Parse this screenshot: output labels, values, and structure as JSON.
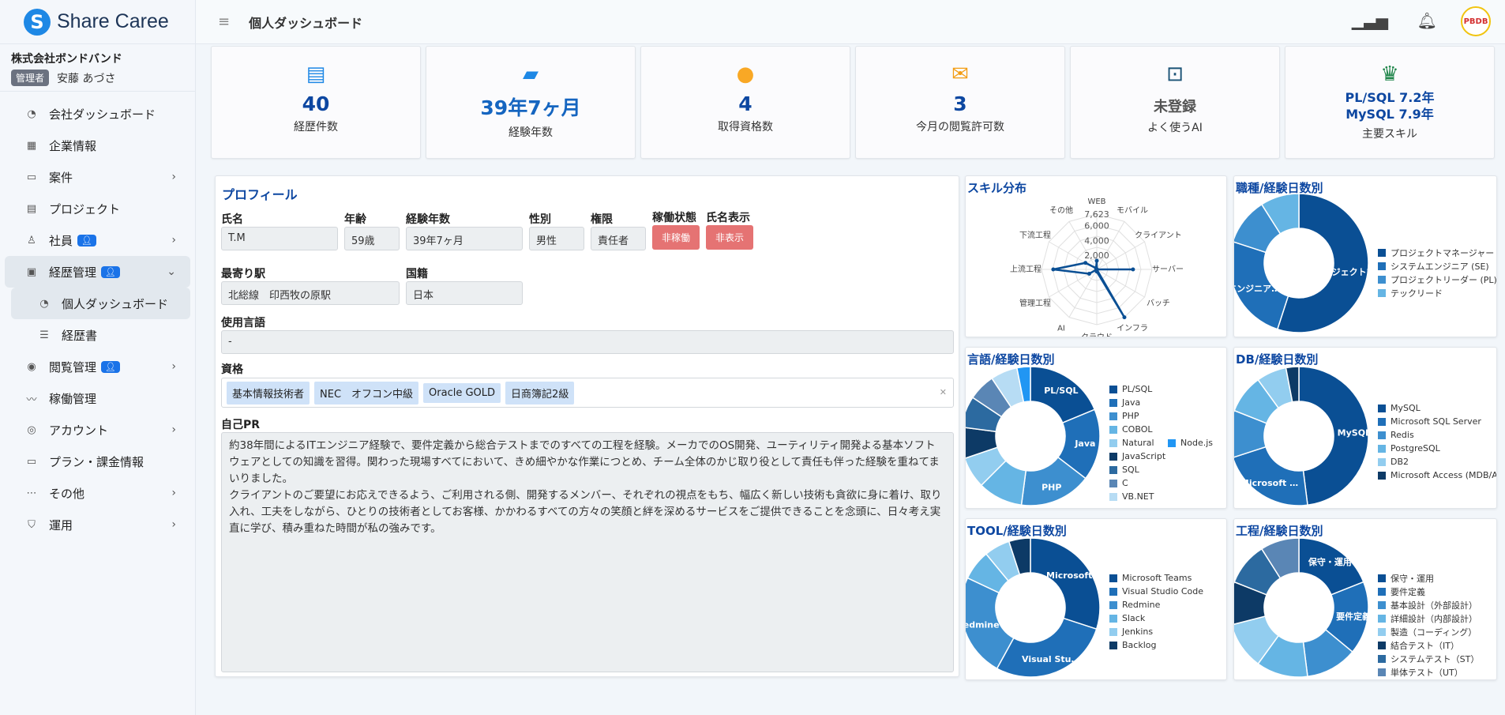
{
  "app": {
    "logo_text": "Share Caree",
    "logo_letter": "S"
  },
  "company": {
    "name": "株式会社ボンドバンド",
    "role": "管理者",
    "user": "安藤 あづさ"
  },
  "nav": [
    {
      "label": "会社ダッシュボード",
      "icon": "dashboard-icon",
      "glyph": "◔",
      "chev": false,
      "badge": false,
      "active": false,
      "sub": false
    },
    {
      "label": "企業情報",
      "icon": "building-icon",
      "glyph": "▦",
      "chev": false,
      "badge": false,
      "active": false,
      "sub": false
    },
    {
      "label": "案件",
      "icon": "briefcase-icon",
      "glyph": "▭",
      "chev": true,
      "badge": false,
      "active": false,
      "sub": false
    },
    {
      "label": "プロジェクト",
      "icon": "project-icon",
      "glyph": "▤",
      "chev": false,
      "badge": false,
      "active": false,
      "sub": false
    },
    {
      "label": "社員",
      "icon": "users-icon",
      "glyph": "♙",
      "chev": true,
      "badge": true,
      "active": false,
      "sub": false
    },
    {
      "label": "経歴管理",
      "icon": "id-card-icon",
      "glyph": "▣",
      "chev": true,
      "badge": true,
      "active": true,
      "sub": false,
      "open": true
    },
    {
      "label": "個人ダッシュボード",
      "icon": "dashboard-icon",
      "glyph": "◔",
      "chev": false,
      "badge": false,
      "active": true,
      "sub": true
    },
    {
      "label": "経歴書",
      "icon": "list-icon",
      "glyph": "☰",
      "chev": false,
      "badge": false,
      "active": false,
      "sub": true
    },
    {
      "label": "閲覧管理",
      "icon": "eye-icon",
      "glyph": "◉",
      "chev": true,
      "badge": true,
      "active": false,
      "sub": false
    },
    {
      "label": "稼働管理",
      "icon": "activity-icon",
      "glyph": "〰",
      "chev": false,
      "badge": false,
      "active": false,
      "sub": false
    },
    {
      "label": "アカウント",
      "icon": "account-icon",
      "glyph": "◎",
      "chev": true,
      "badge": false,
      "active": false,
      "sub": false
    },
    {
      "label": "プラン・課金情報",
      "icon": "billing-icon",
      "glyph": "▭",
      "chev": false,
      "badge": false,
      "active": false,
      "sub": false
    },
    {
      "label": "その他",
      "icon": "more-icon",
      "glyph": "⋯",
      "chev": true,
      "badge": false,
      "active": false,
      "sub": false
    },
    {
      "label": "運用",
      "icon": "shield-icon",
      "glyph": "⛉",
      "chev": true,
      "badge": false,
      "active": false,
      "sub": false
    }
  ],
  "header": {
    "title": "個人ダッシュボード",
    "avatar_text": "PBDB"
  },
  "stats": [
    {
      "icon": "document-icon",
      "glyph": "▤",
      "color": "#1e88e5",
      "value": "40",
      "label": "経歴件数",
      "style": ""
    },
    {
      "icon": "briefcase-icon",
      "glyph": "▰",
      "color": "#1e88e5",
      "value": "39年7ヶ月",
      "label": "経験年数",
      "style": "blue"
    },
    {
      "icon": "award-icon",
      "glyph": "●",
      "color": "#f9a825",
      "value": "4",
      "label": "取得資格数",
      "style": ""
    },
    {
      "icon": "mail-icon",
      "glyph": "✉",
      "color": "#f39c12",
      "value": "3",
      "label": "今月の閲覧許可数",
      "style": ""
    },
    {
      "icon": "robot-icon",
      "glyph": "⊡",
      "color": "#1a5276",
      "value": "未登録",
      "label": "よく使うAI",
      "style": "gray"
    },
    {
      "icon": "trophy-icon",
      "glyph": "♛",
      "color": "#1e8449",
      "value": "PL/SQL 7.2年",
      "value2": "MySQL 7.9年",
      "label": "主要スキル",
      "style": "small"
    }
  ],
  "profile": {
    "title": "プロフィール",
    "labels": {
      "name": "氏名",
      "age": "年齢",
      "exp": "経験年数",
      "gender": "性別",
      "authority": "権限",
      "status": "稼働状態",
      "display": "氏名表示",
      "station": "最寄り駅",
      "nationality": "国籍",
      "languages": "使用言語",
      "quals": "資格",
      "pr": "自己PR"
    },
    "name": "T.M",
    "age": "59歳",
    "exp": "39年7ヶ月",
    "gender": "男性",
    "authority": "責任者",
    "status": "非稼働",
    "display": "非表示",
    "station": "北総線　印西牧の原駅",
    "nationality": "日本",
    "languages": "-",
    "quals": [
      "基本情報技術者",
      "NEC　オフコン中級",
      "Oracle GOLD",
      "日商簿記2級"
    ],
    "pr1": "約38年間によるITエンジニア経験で、要件定義から総合テストまでのすべての工程を経験。メーカでのOS開発、ユーティリティ開発よる基本ソフトウェアとしての知識を習得。関わった現場すべてにおいて、きめ細やかな作業につとめ、チーム全体のかじ取り役として責任も伴った経験を重ねてまいりました。",
    "pr2": "クライアントのご要望にお応えできるよう、ご利用される側、開発するメンバー、それぞれの視点をもち、幅広く新しい技術も貪欲に身に着け、取り入れ、工夫をしながら、ひとりの技術者としてお客様、かかわるすべての方々の笑顔と絆を深めるサービスをご提供できることを念頭に、日々考え実直に学び、積み重ねた時間が私の強みです。"
  },
  "chart_data": [
    {
      "id": "skill",
      "type": "radar",
      "title": "スキル分布",
      "categories": [
        "WEB",
        "モバイル",
        "クライアント",
        "サーバー",
        "バッチ",
        "インフラ",
        "クラウド",
        "AI",
        "管理工程",
        "上流工程",
        "下流工程",
        "その他"
      ],
      "values": [
        1200,
        0,
        0,
        5000,
        0,
        7623,
        300,
        0,
        1200,
        6000,
        1800,
        200
      ],
      "ticks": [
        "2,000",
        "4,000",
        "6,000",
        "7,623"
      ],
      "max": 7623
    },
    {
      "id": "role",
      "type": "pie",
      "title": "職種/経験日数別",
      "series": [
        {
          "name": "プロジェクトマネージャー (PM)",
          "value": 55,
          "color": "#0a4f94"
        },
        {
          "name": "システムエンジニア (SE)",
          "value": 25,
          "color": "#1f6fb8"
        },
        {
          "name": "プロジェクトリーダー (PL)",
          "value": 11,
          "color": "#3d8fcf"
        },
        {
          "name": "テックリード",
          "value": 9,
          "color": "#65b5e4"
        }
      ],
      "inner_labels": [
        "プロジェクトマネ…",
        "ムエンジニア…"
      ]
    },
    {
      "id": "lang",
      "type": "pie",
      "title": "言語/経験日数別",
      "series": [
        {
          "name": "PL/SQL",
          "value": 18,
          "color": "#0a4f94"
        },
        {
          "name": "Java",
          "value": 16,
          "color": "#1f6fb8"
        },
        {
          "name": "PHP",
          "value": 16,
          "color": "#3d8fcf"
        },
        {
          "name": "COBOL",
          "value": 10,
          "color": "#65b5e4"
        },
        {
          "name": "Natural",
          "value": 7,
          "color": "#92cdef"
        },
        {
          "name": "JavaScript",
          "value": 7,
          "color": "#0d3a66"
        },
        {
          "name": "SQL",
          "value": 7,
          "color": "#2c6aa0"
        },
        {
          "name": "C",
          "value": 6,
          "color": "#5a86b5"
        },
        {
          "name": "VB.NET",
          "value": 6,
          "color": "#b7dcf4"
        },
        {
          "name": "Node.js",
          "value": 3,
          "color": "#2196f3"
        }
      ],
      "inner_labels": [
        "PL/SQL",
        "Java",
        "PHP"
      ]
    },
    {
      "id": "db",
      "type": "pie",
      "title": "DB/経験日数別",
      "series": [
        {
          "name": "MySQL",
          "value": 48,
          "color": "#0a4f94"
        },
        {
          "name": "Microsoft SQL Server",
          "value": 22,
          "color": "#1f6fb8"
        },
        {
          "name": "Redis",
          "value": 11,
          "color": "#3d8fcf"
        },
        {
          "name": "PostgreSQL",
          "value": 9,
          "color": "#65b5e4"
        },
        {
          "name": "DB2",
          "value": 7,
          "color": "#92cdef"
        },
        {
          "name": "Microsoft Access (MDB/ACCDB)",
          "value": 3,
          "color": "#0d3a66"
        }
      ],
      "inner_labels": [
        "MySQL",
        "Microsoft …"
      ]
    },
    {
      "id": "tool",
      "type": "pie",
      "title": "TOOL/経験日数別",
      "series": [
        {
          "name": "Microsoft Teams",
          "value": 30,
          "color": "#0a4f94"
        },
        {
          "name": "Visual Studio Code",
          "value": 28,
          "color": "#1f6fb8"
        },
        {
          "name": "Redmine",
          "value": 24,
          "color": "#3d8fcf"
        },
        {
          "name": "Slack",
          "value": 7,
          "color": "#65b5e4"
        },
        {
          "name": "Jenkins",
          "value": 6,
          "color": "#92cdef"
        },
        {
          "name": "Backlog",
          "value": 5,
          "color": "#0d3a66"
        }
      ],
      "inner_labels": [
        "Microsoft …",
        "Visual Stu…",
        "Redmine"
      ]
    },
    {
      "id": "process",
      "type": "pie",
      "title": "工程/経験日数別",
      "series": [
        {
          "name": "保守・運用",
          "value": 19,
          "color": "#0a4f94"
        },
        {
          "name": "要件定義",
          "value": 17,
          "color": "#1f6fb8"
        },
        {
          "name": "基本設計（外部設計）",
          "value": 12,
          "color": "#3d8fcf"
        },
        {
          "name": "詳細設計（内部設計）",
          "value": 12,
          "color": "#65b5e4"
        },
        {
          "name": "製造（コーディング）",
          "value": 11,
          "color": "#92cdef"
        },
        {
          "name": "結合テスト（IT）",
          "value": 10,
          "color": "#0d3a66"
        },
        {
          "name": "システムテスト（ST）",
          "value": 10,
          "color": "#2c6aa0"
        },
        {
          "name": "単体テスト（UT）",
          "value": 9,
          "color": "#5a86b5"
        }
      ],
      "inner_labels": [
        "保守・運用",
        "要件定義"
      ]
    }
  ]
}
